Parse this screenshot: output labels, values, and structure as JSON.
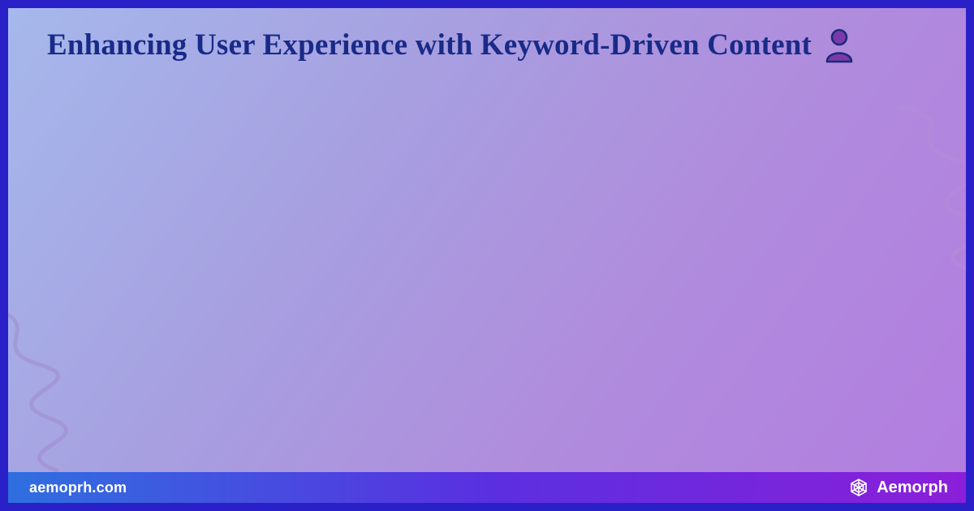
{
  "header": {
    "title": "Enhancing User Experience with Keyword-Driven Content",
    "icon": "person-icon"
  },
  "footer": {
    "site": "aemoprh.com",
    "brand": "Aemorph"
  },
  "colors": {
    "frame": "#2921c7",
    "title_text": "#192a87",
    "icon_fill": "#7a3aa9",
    "icon_stroke": "#1d2a7a"
  }
}
